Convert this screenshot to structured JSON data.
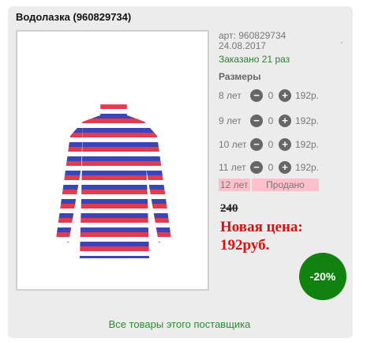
{
  "product": {
    "title": "Водолазка (960829734)",
    "article": "арт: 960829734",
    "date": "24.08.2017",
    "ordered": "Заказано 21 раз",
    "image_icon": "striped-turtleneck-image"
  },
  "sizes": {
    "header": "Размеры",
    "rows": [
      {
        "label": "8 лет",
        "qty": "0",
        "price": "192р."
      },
      {
        "label": "9 лет",
        "qty": "0",
        "price": "192р."
      },
      {
        "label": "10 лет",
        "qty": "0",
        "price": "192р."
      },
      {
        "label": "11 лет",
        "qty": "0",
        "price": "192р."
      }
    ],
    "sold": {
      "label": "12 лет",
      "status": "Продано"
    },
    "minus_symbol": "−",
    "plus_symbol": "+"
  },
  "pricing": {
    "old_price": "240",
    "new_price": "Новая цена: 192руб.",
    "discount": "-20%"
  },
  "footer": {
    "supplier_link": "Все товары этого поставщика"
  },
  "colors": {
    "new_price": "#d91010",
    "discount_badge": "#11820f",
    "sold_bg": "#ffc0cb",
    "link": "#2e8b2e"
  }
}
